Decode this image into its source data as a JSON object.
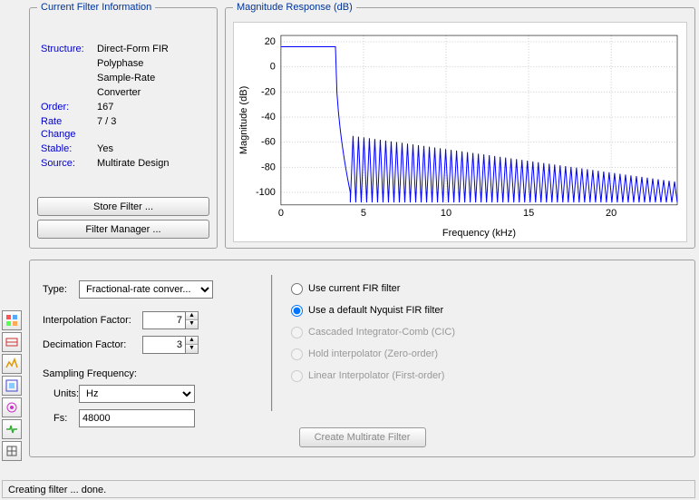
{
  "filter_info": {
    "legend": "Current Filter Information",
    "structure_label": "Structure:",
    "structure_value_l1": "Direct-Form FIR",
    "structure_value_l2": "Polyphase",
    "structure_value_l3": "Sample-Rate",
    "structure_value_l4": "Converter",
    "order_label": "Order:",
    "order_value": "167",
    "rate_label": "Rate Change",
    "rate_value": "7 / 3",
    "stable_label": "Stable:",
    "stable_value": "Yes",
    "source_label": "Source:",
    "source_value": "Multirate Design",
    "store_btn": "Store Filter ...",
    "manager_btn": "Filter Manager ..."
  },
  "mag_resp": {
    "legend": "Magnitude Response (dB)"
  },
  "params": {
    "type_label": "Type:",
    "type_value": "Fractional-rate conver...",
    "interp_label": "Interpolation Factor:",
    "interp_value": "7",
    "decim_label": "Decimation Factor:",
    "decim_value": "3",
    "sf_heading": "Sampling Frequency:",
    "units_label": "Units:",
    "units_value": "Hz",
    "fs_label": "Fs:",
    "fs_value": "48000"
  },
  "radios": {
    "r1": "Use current FIR filter",
    "r2": "Use a default Nyquist FIR filter",
    "r3": "Cascaded Integrator-Comb (CIC)",
    "r4": "Hold interpolator (Zero-order)",
    "r5": "Linear Interpolator (First-order)"
  },
  "create_btn": "Create Multirate Filter",
  "status": "Creating filter ... done.",
  "chart_data": {
    "type": "line",
    "title": "",
    "xlabel": "Frequency (kHz)",
    "ylabel": "Magnitude (dB)",
    "xlim": [
      0,
      24
    ],
    "ylim": [
      -110,
      25
    ],
    "xticks": [
      0,
      5,
      10,
      15,
      20
    ],
    "yticks": [
      20,
      0,
      -20,
      -40,
      -60,
      -80,
      -100
    ],
    "series": [
      {
        "name": "response",
        "color": "#0000ff",
        "segments": [
          {
            "type": "flat",
            "x": [
              0,
              3.3
            ],
            "y": 16
          },
          {
            "type": "transition",
            "x": [
              3.3,
              4.2
            ],
            "y": [
              16,
              -100
            ]
          },
          {
            "type": "ripple",
            "x": [
              4.2,
              24
            ],
            "envelope_top": [
              -55,
              -92
            ],
            "envelope_bottom": -108,
            "lobes": 60
          }
        ]
      }
    ]
  }
}
